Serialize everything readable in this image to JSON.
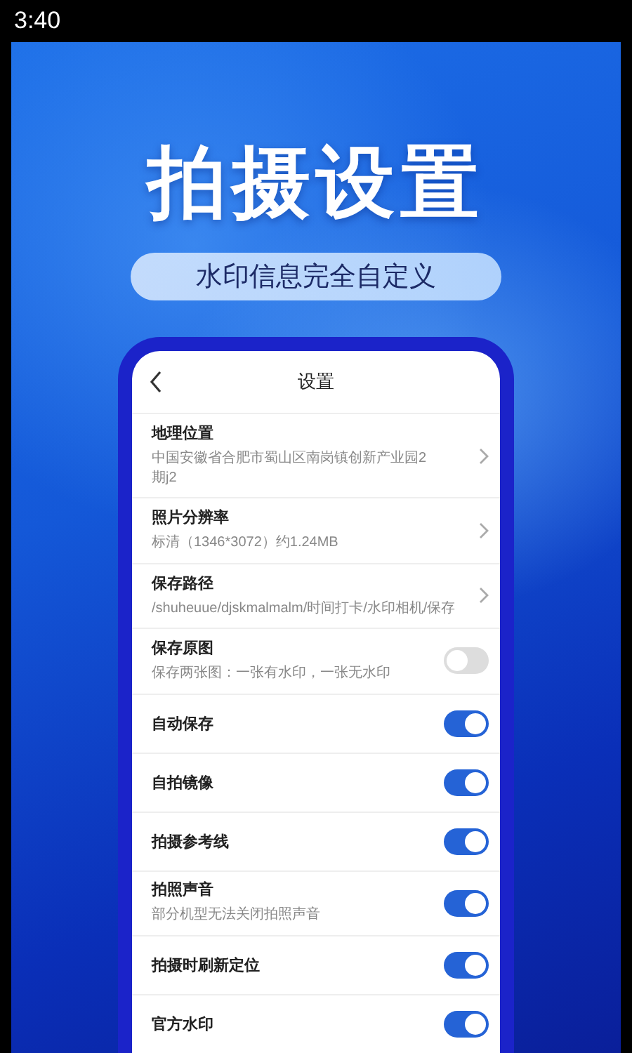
{
  "status_bar": {
    "time": "3:40"
  },
  "headline": "拍摄设置",
  "tagline": "水印信息完全自定义",
  "phone": {
    "title": "设置",
    "settings": [
      {
        "kind": "link",
        "label": "地理位置",
        "detail": "中国安徽省合肥市蜀山区南岗镇创新产业园2期j2"
      },
      {
        "kind": "link",
        "label": "照片分辨率",
        "detail": "标清（1346*3072）约1.24MB"
      },
      {
        "kind": "link",
        "label": "保存路径",
        "detail": "/shuheuue/djskmalmalm/时间打卡/水印相机/保存"
      },
      {
        "kind": "toggle",
        "label": "保存原图",
        "detail": "保存两张图：一张有水印，一张无水印",
        "on": false
      },
      {
        "kind": "toggle",
        "label": "自动保存",
        "on": true
      },
      {
        "kind": "toggle",
        "label": "自拍镜像",
        "on": true
      },
      {
        "kind": "toggle",
        "label": "拍摄参考线",
        "on": true
      },
      {
        "kind": "toggle",
        "label": "拍照声音",
        "detail": "部分机型无法关闭拍照声音",
        "on": true
      },
      {
        "kind": "toggle",
        "label": "拍摄时刷新定位",
        "on": true
      },
      {
        "kind": "toggle",
        "label": "官方水印",
        "on": true
      }
    ]
  }
}
